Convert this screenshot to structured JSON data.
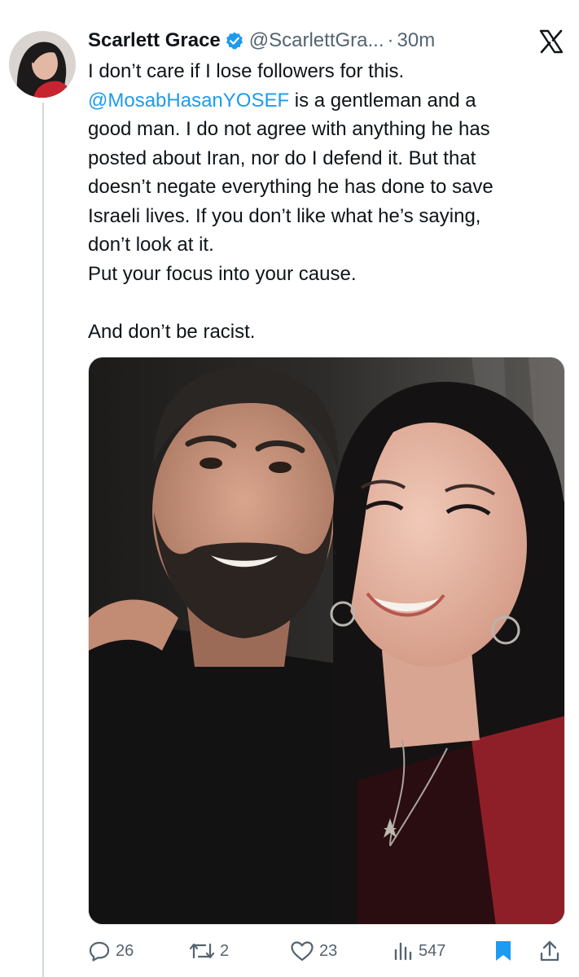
{
  "author": {
    "display_name": "Scarlett Grace",
    "handle": "@ScarlettGra...",
    "separator": "·",
    "time": "30m",
    "verified": true
  },
  "tweet": {
    "lines_1": [
      "I don’t care if I lose followers for this."
    ],
    "mention": "@MosabHasanYOSEF",
    "mention_rest": " is a gentleman and a",
    "lines_2": [
      "good man. I do not agree with anything he has",
      "posted about Iran, nor do I defend it. But that",
      "doesn’t negate everything he has done to save",
      "Israeli lives. If you don’t like what he’s saying,",
      "don’t look at it.",
      "Put your focus into your cause."
    ],
    "last_line": "And don’t be racist."
  },
  "actions": {
    "replies": "26",
    "reposts": "2",
    "likes": "23",
    "views": "547"
  },
  "icons": {
    "verified": "verified-badge-icon",
    "logo": "x-logo-icon",
    "reply": "reply-icon",
    "repost": "repost-icon",
    "like": "heart-icon",
    "views": "views-chart-icon",
    "bookmark": "bookmark-icon",
    "share": "share-icon"
  },
  "colors": {
    "accent": "#1d9bf0",
    "text": "#0f1419",
    "secondary": "#536471"
  }
}
